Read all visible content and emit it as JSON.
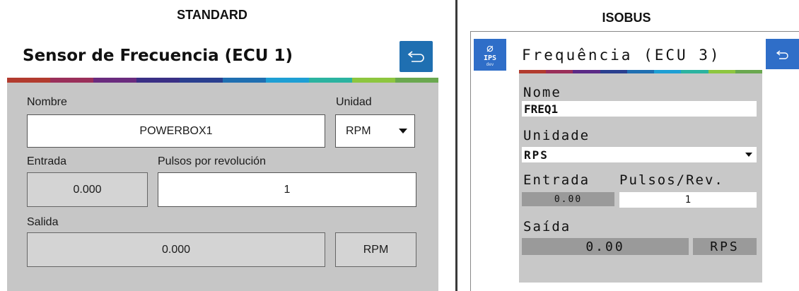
{
  "standard": {
    "heading": "STANDARD",
    "title": "Sensor de Frecuencia (ECU 1)",
    "back_icon": "undo-arrow-icon",
    "name_label": "Nombre",
    "name_value": "POWERBOX1",
    "unit_label": "Unidad",
    "unit_value": "RPM",
    "input_label": "Entrada",
    "input_value": "0.000",
    "pulses_label": "Pulsos por revolución",
    "pulses_value": "1",
    "output_label": "Salida",
    "output_value": "0.000",
    "output_unit": "RPM"
  },
  "isobus": {
    "heading": "ISOBUS",
    "ips_icon": "leaf-icon",
    "ips_label": "IPS",
    "ips_sub": "dev",
    "title": "Frequência (ECU 3)",
    "back_icon": "undo-arrow-icon",
    "name_label": "Nome",
    "name_value": "FREQ1",
    "unit_label": "Unidade",
    "unit_value": "RPS",
    "input_label": "Entrada",
    "pulses_label": "Pulsos/Rev.",
    "input_value": "0.00",
    "pulses_value": "1",
    "output_label": "Saída",
    "output_value": "0.00",
    "output_unit": "RPS"
  },
  "colors": {
    "back_button_standard": "#1f6fb1",
    "back_button_isobus": "#2f6ec8",
    "panel_gray": "#c6c6c6",
    "rainbow": [
      "#c0392b",
      "#8e2c6e",
      "#5b2a86",
      "#2a3f8f",
      "#1f6fb1",
      "#1e9fd4",
      "#2bb3a0",
      "#8dc63f",
      "#6aa84f"
    ]
  }
}
